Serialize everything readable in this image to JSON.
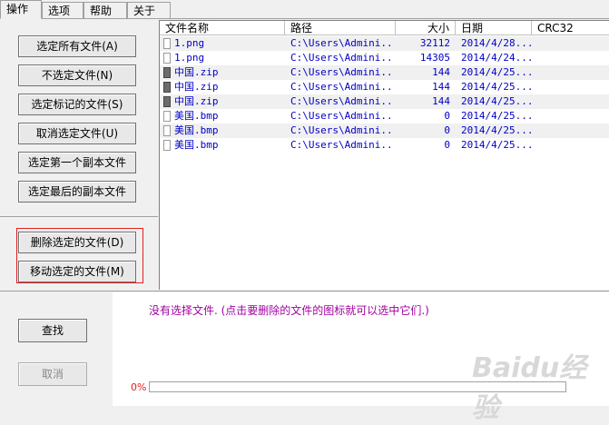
{
  "tabs": [
    {
      "label": "操作",
      "active": true
    },
    {
      "label": "选项",
      "active": false
    },
    {
      "label": "帮助",
      "active": false
    },
    {
      "label": "关于",
      "active": false
    }
  ],
  "actions": {
    "select_all": "选定所有文件(A)",
    "deselect": "不选定文件(N)",
    "select_marked": "选定标记的文件(S)",
    "cancel_select": "取消选定文件(U)",
    "select_first_copy": "选定第一个副本文件",
    "select_last_copy": "选定最后的副本文件",
    "delete_selected": "删除选定的文件(D)",
    "move_selected": "移动选定的文件(M)"
  },
  "columns": {
    "name": "文件名称",
    "path": "路径",
    "size": "大小",
    "date": "日期",
    "crc": "CRC32"
  },
  "files": [
    {
      "name": "1.png",
      "path": "C:\\Users\\Admini...",
      "size": "32112",
      "date": "2014/4/28...",
      "icon": "image-file-icon"
    },
    {
      "name": "1.png",
      "path": "C:\\Users\\Admini...",
      "size": "14305",
      "date": "2014/4/24...",
      "icon": "image-file-icon"
    },
    {
      "name": "中国.zip",
      "path": "C:\\Users\\Admini...",
      "size": "144",
      "date": "2014/4/25...",
      "icon": "zip-file-icon"
    },
    {
      "name": "中国.zip",
      "path": "C:\\Users\\Admini...",
      "size": "144",
      "date": "2014/4/25...",
      "icon": "zip-file-icon"
    },
    {
      "name": "中国.zip",
      "path": "C:\\Users\\Admini...",
      "size": "144",
      "date": "2014/4/25...",
      "icon": "zip-file-icon"
    },
    {
      "name": "美国.bmp",
      "path": "C:\\Users\\Admini...",
      "size": "0",
      "date": "2014/4/25...",
      "icon": "image-file-icon"
    },
    {
      "name": "美国.bmp",
      "path": "C:\\Users\\Admini...",
      "size": "0",
      "date": "2014/4/25...",
      "icon": "image-file-icon"
    },
    {
      "name": "美国.bmp",
      "path": "C:\\Users\\Admini...",
      "size": "0",
      "date": "2014/4/25...",
      "icon": "image-file-icon"
    }
  ],
  "bottom": {
    "find": "查找",
    "cancel": "取消",
    "status": "没有选择文件. (点击要删除的文件的图标就可以选中它们.)",
    "progress_label": "0%",
    "progress": 0
  },
  "watermark": "Baidu经验",
  "colors": {
    "file_text": "#0000c8",
    "status_text": "#a000a0",
    "highlight_box": "#e02020"
  }
}
